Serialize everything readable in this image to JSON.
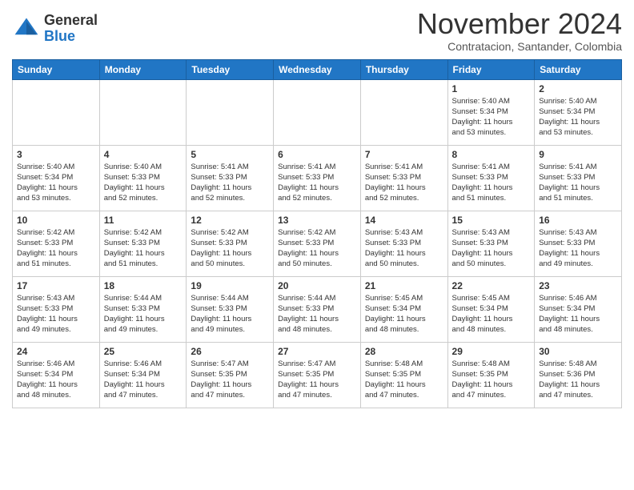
{
  "header": {
    "logo_line1": "General",
    "logo_line2": "Blue",
    "month": "November 2024",
    "location": "Contratacion, Santander, Colombia"
  },
  "weekdays": [
    "Sunday",
    "Monday",
    "Tuesday",
    "Wednesday",
    "Thursday",
    "Friday",
    "Saturday"
  ],
  "weeks": [
    [
      {
        "day": "",
        "info": ""
      },
      {
        "day": "",
        "info": ""
      },
      {
        "day": "",
        "info": ""
      },
      {
        "day": "",
        "info": ""
      },
      {
        "day": "",
        "info": ""
      },
      {
        "day": "1",
        "info": "Sunrise: 5:40 AM\nSunset: 5:34 PM\nDaylight: 11 hours\nand 53 minutes."
      },
      {
        "day": "2",
        "info": "Sunrise: 5:40 AM\nSunset: 5:34 PM\nDaylight: 11 hours\nand 53 minutes."
      }
    ],
    [
      {
        "day": "3",
        "info": "Sunrise: 5:40 AM\nSunset: 5:34 PM\nDaylight: 11 hours\nand 53 minutes."
      },
      {
        "day": "4",
        "info": "Sunrise: 5:40 AM\nSunset: 5:33 PM\nDaylight: 11 hours\nand 52 minutes."
      },
      {
        "day": "5",
        "info": "Sunrise: 5:41 AM\nSunset: 5:33 PM\nDaylight: 11 hours\nand 52 minutes."
      },
      {
        "day": "6",
        "info": "Sunrise: 5:41 AM\nSunset: 5:33 PM\nDaylight: 11 hours\nand 52 minutes."
      },
      {
        "day": "7",
        "info": "Sunrise: 5:41 AM\nSunset: 5:33 PM\nDaylight: 11 hours\nand 52 minutes."
      },
      {
        "day": "8",
        "info": "Sunrise: 5:41 AM\nSunset: 5:33 PM\nDaylight: 11 hours\nand 51 minutes."
      },
      {
        "day": "9",
        "info": "Sunrise: 5:41 AM\nSunset: 5:33 PM\nDaylight: 11 hours\nand 51 minutes."
      }
    ],
    [
      {
        "day": "10",
        "info": "Sunrise: 5:42 AM\nSunset: 5:33 PM\nDaylight: 11 hours\nand 51 minutes."
      },
      {
        "day": "11",
        "info": "Sunrise: 5:42 AM\nSunset: 5:33 PM\nDaylight: 11 hours\nand 51 minutes."
      },
      {
        "day": "12",
        "info": "Sunrise: 5:42 AM\nSunset: 5:33 PM\nDaylight: 11 hours\nand 50 minutes."
      },
      {
        "day": "13",
        "info": "Sunrise: 5:42 AM\nSunset: 5:33 PM\nDaylight: 11 hours\nand 50 minutes."
      },
      {
        "day": "14",
        "info": "Sunrise: 5:43 AM\nSunset: 5:33 PM\nDaylight: 11 hours\nand 50 minutes."
      },
      {
        "day": "15",
        "info": "Sunrise: 5:43 AM\nSunset: 5:33 PM\nDaylight: 11 hours\nand 50 minutes."
      },
      {
        "day": "16",
        "info": "Sunrise: 5:43 AM\nSunset: 5:33 PM\nDaylight: 11 hours\nand 49 minutes."
      }
    ],
    [
      {
        "day": "17",
        "info": "Sunrise: 5:43 AM\nSunset: 5:33 PM\nDaylight: 11 hours\nand 49 minutes."
      },
      {
        "day": "18",
        "info": "Sunrise: 5:44 AM\nSunset: 5:33 PM\nDaylight: 11 hours\nand 49 minutes."
      },
      {
        "day": "19",
        "info": "Sunrise: 5:44 AM\nSunset: 5:33 PM\nDaylight: 11 hours\nand 49 minutes."
      },
      {
        "day": "20",
        "info": "Sunrise: 5:44 AM\nSunset: 5:33 PM\nDaylight: 11 hours\nand 48 minutes."
      },
      {
        "day": "21",
        "info": "Sunrise: 5:45 AM\nSunset: 5:34 PM\nDaylight: 11 hours\nand 48 minutes."
      },
      {
        "day": "22",
        "info": "Sunrise: 5:45 AM\nSunset: 5:34 PM\nDaylight: 11 hours\nand 48 minutes."
      },
      {
        "day": "23",
        "info": "Sunrise: 5:46 AM\nSunset: 5:34 PM\nDaylight: 11 hours\nand 48 minutes."
      }
    ],
    [
      {
        "day": "24",
        "info": "Sunrise: 5:46 AM\nSunset: 5:34 PM\nDaylight: 11 hours\nand 48 minutes."
      },
      {
        "day": "25",
        "info": "Sunrise: 5:46 AM\nSunset: 5:34 PM\nDaylight: 11 hours\nand 47 minutes."
      },
      {
        "day": "26",
        "info": "Sunrise: 5:47 AM\nSunset: 5:35 PM\nDaylight: 11 hours\nand 47 minutes."
      },
      {
        "day": "27",
        "info": "Sunrise: 5:47 AM\nSunset: 5:35 PM\nDaylight: 11 hours\nand 47 minutes."
      },
      {
        "day": "28",
        "info": "Sunrise: 5:48 AM\nSunset: 5:35 PM\nDaylight: 11 hours\nand 47 minutes."
      },
      {
        "day": "29",
        "info": "Sunrise: 5:48 AM\nSunset: 5:35 PM\nDaylight: 11 hours\nand 47 minutes."
      },
      {
        "day": "30",
        "info": "Sunrise: 5:48 AM\nSunset: 5:36 PM\nDaylight: 11 hours\nand 47 minutes."
      }
    ]
  ]
}
